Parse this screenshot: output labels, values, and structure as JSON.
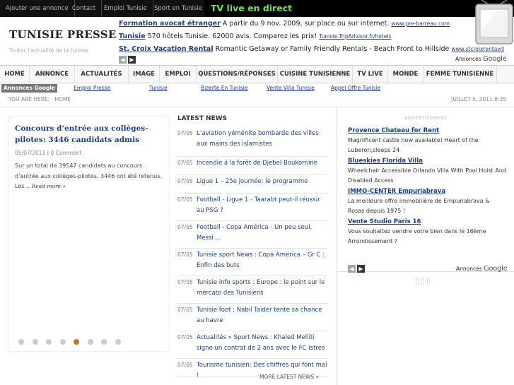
{
  "topbar": {
    "links": [
      "Ajouter une annonce",
      "Contact",
      "Emploi Tunisie",
      "Sport en Tunisie"
    ],
    "live": "TV live en direct"
  },
  "header": {
    "brand": "TUNISIE PRESSE",
    "tagline": "Toutes l'actualité de la tunisie"
  },
  "top_ads": [
    {
      "title": "Formation avocat étranger",
      "text": "A partir du 9 nov. 2009, sur place ou sur internet.",
      "url": "www.pre-barreau.com"
    },
    {
      "title": "Tunisie",
      "text": "570 hôtels Tunisie. 62000 avis. Comparez les prix!",
      "url": "Tunisie.TripAdvisor.fr/hotels"
    },
    {
      "title": "St. Croix Vacation Rental",
      "text": "Romantic Getaway or Family Friendly Rentals - Beach Front to Hillside",
      "url": "www.stcroixrentavilla.com"
    }
  ],
  "ads_by": {
    "label": "Annonces",
    "brand": "Google"
  },
  "nav_arrows": {
    "prev": "◀",
    "next": "▶"
  },
  "main_nav": [
    "HOME",
    "ANNONCE",
    "ACTUALITÉS",
    "IMAGE",
    "EMPLOI",
    "QUESTIONS/RÉPONSES",
    "CUISINE TUNISIENNE",
    "TV LIVE",
    "MONDE",
    "FEMME TUNISIENNE"
  ],
  "link_bar": {
    "label": "Annonces Google",
    "links": [
      "Emploi Presse",
      "Tunisie",
      "Bizerte En Tunisie",
      "Vente Villa Tunisie",
      "Appel Offre Tunisie"
    ]
  },
  "breadcrumb": {
    "prefix": "YOU ARE HERE:",
    "current": "HOME",
    "date": "JUILLET 5, 2011 6:35"
  },
  "feature": {
    "title": "Concours d’entrée aux collèges-pilotes: 3446 candidats admis",
    "date": "05/07/2011",
    "sep": "|",
    "comments": "0 Comment",
    "excerpt": "Sur un total de 39547 candidats au concours d’entrée aux collèges-pilotes, 3446 ont été retenus. Les...",
    "read_more": "Read more »",
    "slide_count": 8,
    "active_slide": 5
  },
  "latest": {
    "heading": "LATEST NEWS",
    "items": [
      {
        "date": "07/05",
        "title": "L’aviation yéménite bombarde des villes aux mains des islamistes"
      },
      {
        "date": "07/05",
        "title": "Incendie à la forêt de Djebel Boukornine"
      },
      {
        "date": "07/05",
        "title": "Ligue 1 – 25e journée: le programme"
      },
      {
        "date": "07/05",
        "title": "Football - Ligue 1 - Taarabt peut-il réussir au PSG ?"
      },
      {
        "date": "07/05",
        "title": "Football - Copa América - Un peu seul, Messi ..."
      },
      {
        "date": "07/05",
        "title": "Tunisie sport News : Copa America – Gr C : Enfin des buts"
      },
      {
        "date": "07/05",
        "title": "Tunisie info sports : Europe : le point sur le mercato des Tunisiens"
      },
      {
        "date": "07/05",
        "title": "Tunisie foot : Nabil Taïder tente sa chance au havre"
      },
      {
        "date": "07/05",
        "title": "Actualités » Sport News : Khaled Melliti signe un contrat de 2 ans avec le FC Istres"
      },
      {
        "date": "07/05",
        "title": "Tourisme tunisien: Des chiffres qui font mal !"
      }
    ],
    "more": "MORE LATEST NEWS »"
  },
  "right": {
    "advertisement": "ADVERTISEMENT",
    "ads": [
      {
        "title": "Provence Chateau for Rent",
        "body": "Magnificent castle now available! Heart of the Luberon,sleeps 24"
      },
      {
        "title": "Blueskies Florida Villa",
        "body": "Wheelchair Accessible Orlando Villa With Pool Hoist And Disabled Access"
      },
      {
        "title": "IMMO-CENTER Empuriabrava",
        "body": "La meilleure offre immobilière de Empuriabrava & Rosas depuis 1975 !"
      },
      {
        "title": "Vente Studio Paris 16",
        "body": "Vous souhaitez vendre votre bien dans le 16ème Arrondissement ?"
      }
    ],
    "loading": "▯▯▯"
  },
  "colors": {
    "accent_link": "#1c3d8f",
    "live_green": "#77e04e",
    "active_dot": "#c9731d"
  }
}
